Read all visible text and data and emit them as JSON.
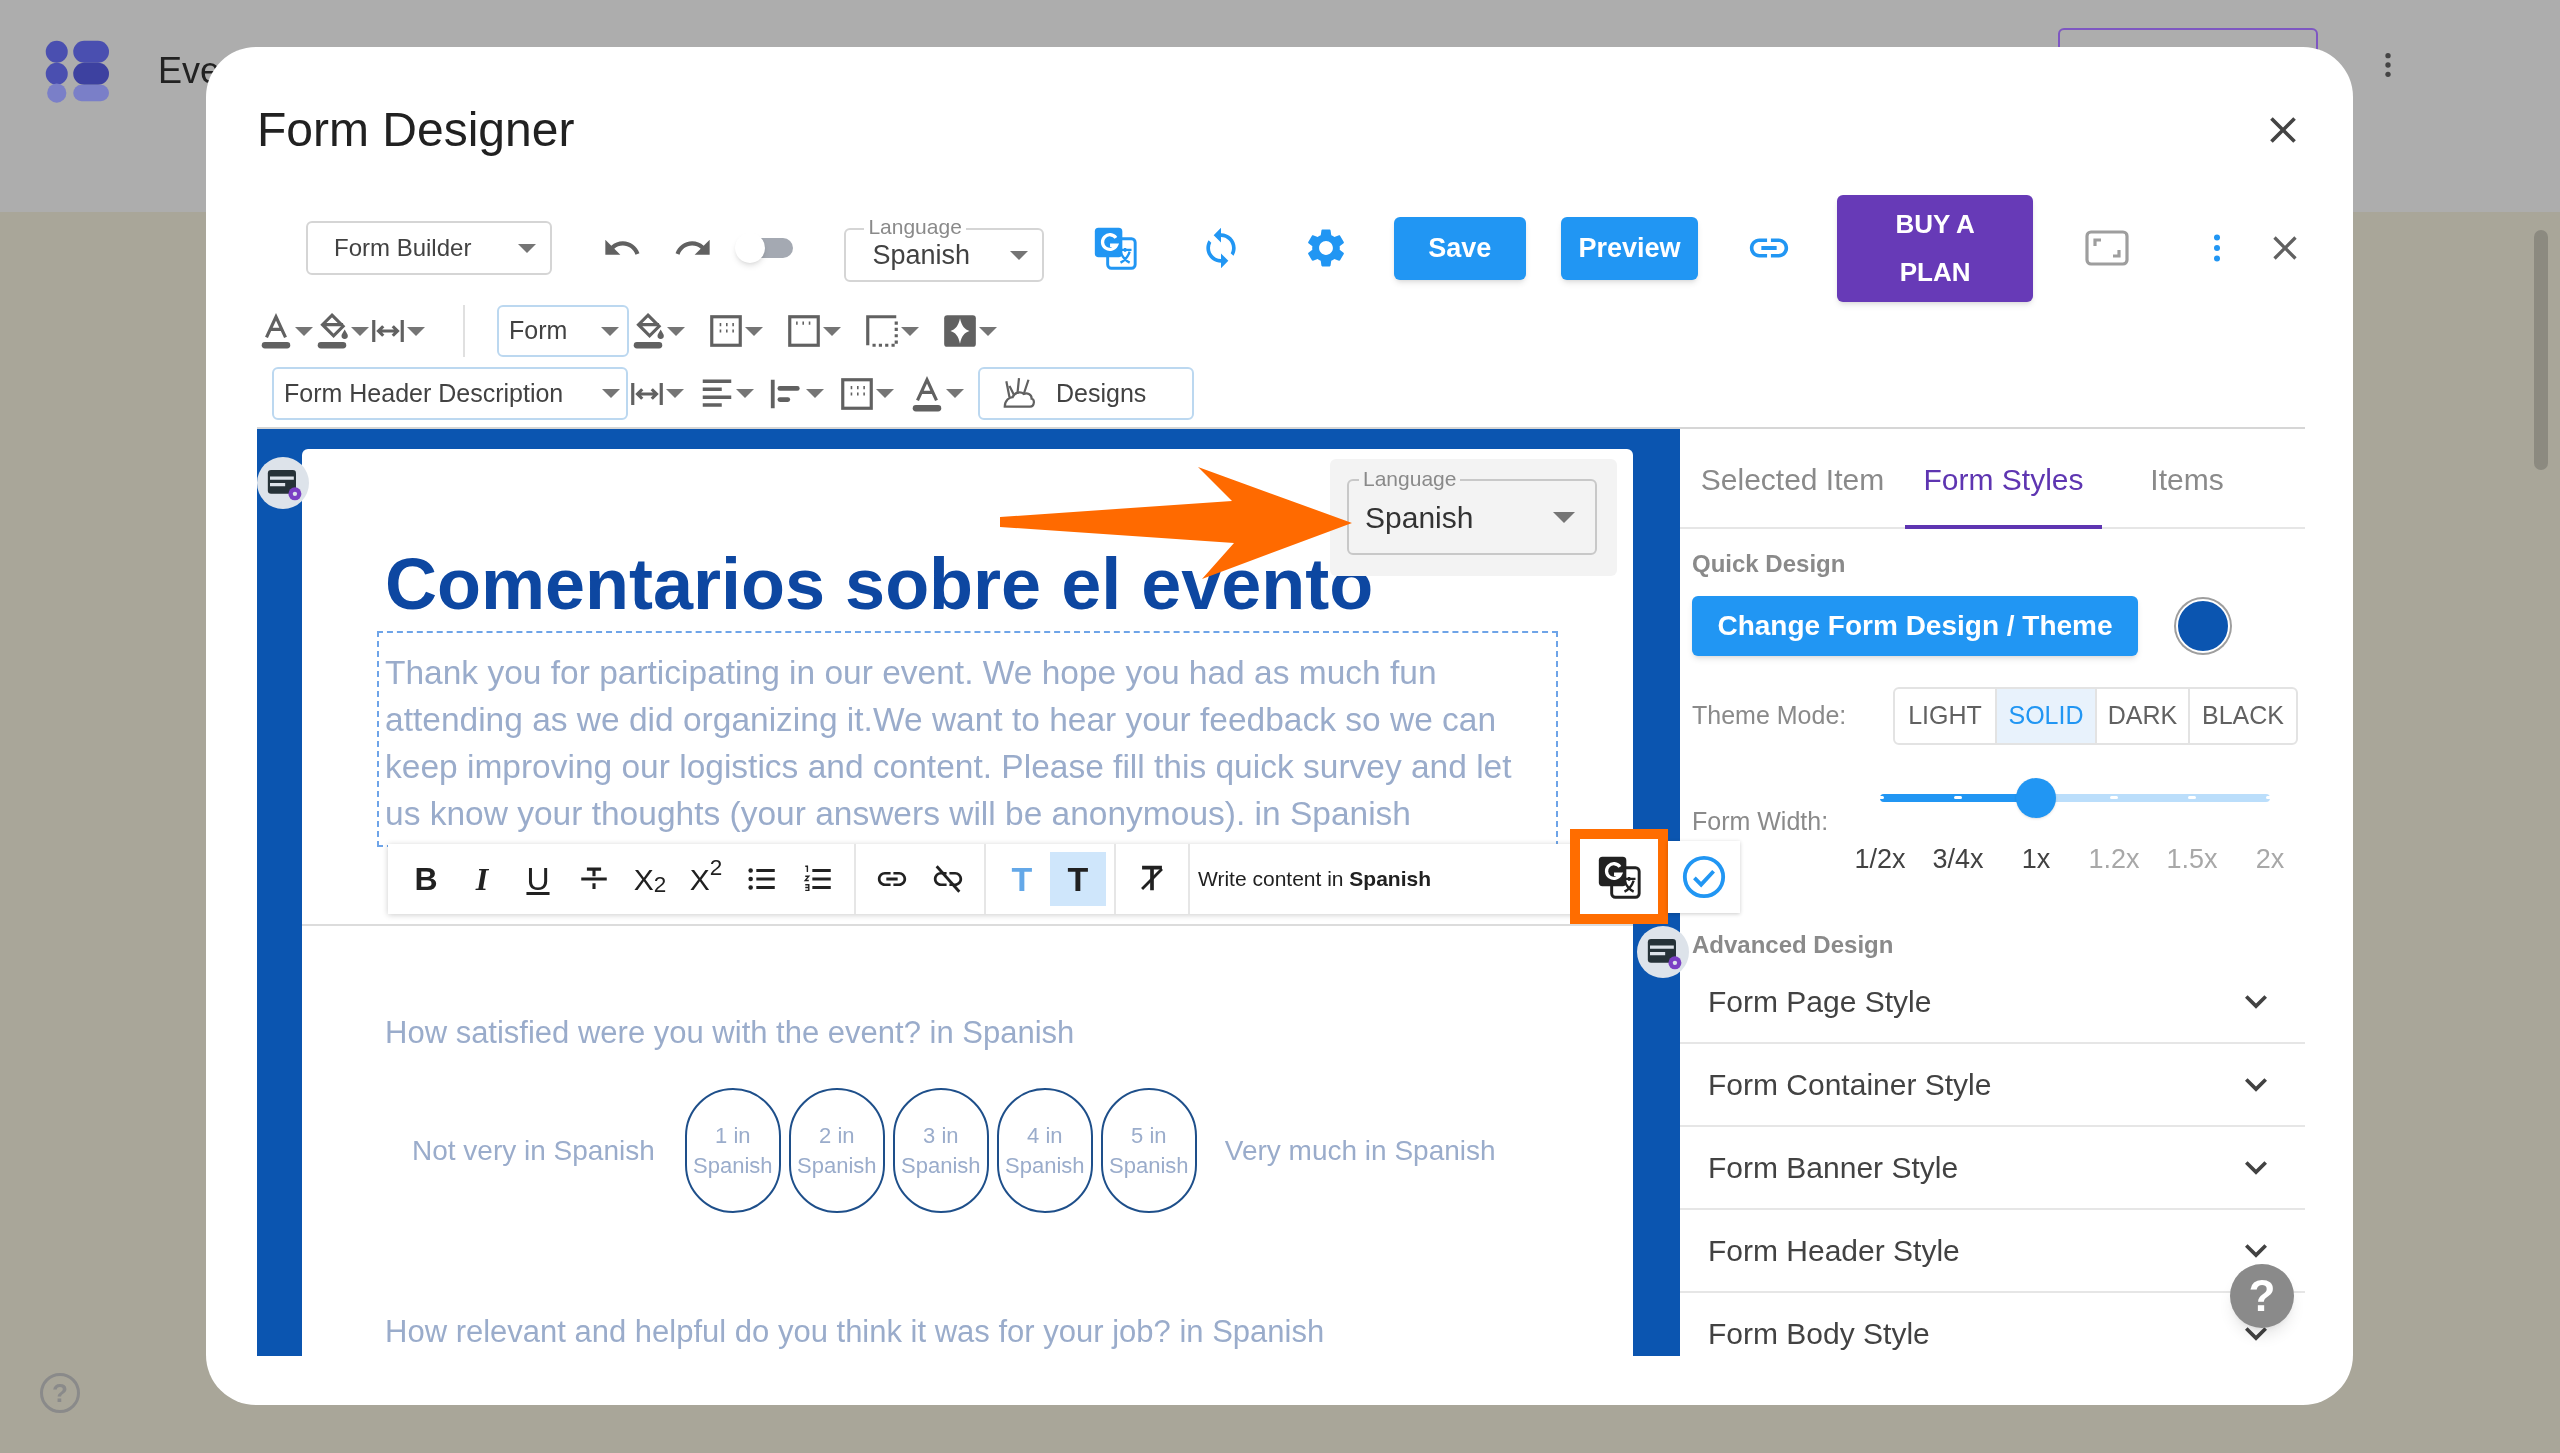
{
  "app_header": {
    "title": "Eve",
    "help_glyph": "?"
  },
  "dialog": {
    "title": "Form Designer"
  },
  "toolbar": {
    "view": "Form Builder",
    "sync_on": false,
    "language": {
      "label": "Language",
      "value": "Spanish"
    },
    "save": "Save",
    "preview": "Preview",
    "plan": "BUY A PLAN"
  },
  "format_bar": {
    "scope": "Form",
    "element": "Form Header Description",
    "designs": "Designs"
  },
  "form": {
    "language": {
      "label": "Language",
      "value": "Spanish"
    },
    "title": "Comentarios sobre el evento",
    "description": "Thank you for participating in our event. We hope you had as much fun attending as we did organizing it.We want to hear your feedback so we can keep improving our logistics and content. Please fill this quick survey and let us know your thoughts (your answers will be anonymous). in Spanish",
    "editor": {
      "tool_groups": [
        [
          {
            "kind": "bold",
            "glyph": "B",
            "active": false
          },
          {
            "kind": "italic",
            "glyph": "I",
            "active": false
          },
          {
            "kind": "underline",
            "glyph": "U",
            "active": false
          },
          {
            "kind": "strikethrough",
            "active": false
          },
          {
            "kind": "subscript",
            "glyph": "X$_{2}$",
            "active": false
          },
          {
            "kind": "superscript",
            "glyph": "X$^{2}$",
            "active": false
          },
          {
            "kind": "bullets",
            "active": false
          },
          {
            "kind": "numbered",
            "active": false
          }
        ],
        [
          {
            "kind": "link",
            "active": false
          },
          {
            "kind": "unlink",
            "active": false
          }
        ],
        [
          {
            "kind": "text-color",
            "glyph": "T",
            "active": false
          },
          {
            "kind": "highlight",
            "glyph": "T",
            "active": true
          }
        ],
        [
          {
            "kind": "clear-format",
            "active": false
          }
        ]
      ],
      "hint": "Write content in **Spanish**",
      "translate_highlighted": true
    },
    "questions": [
      {
        "text": "How satisfied were you with the event? in Spanish",
        "scale": {
          "low": "Not very in Spanish",
          "options": [
            "1 in Spanish",
            "2 in Spanish",
            "3 in Spanish",
            "4 in Spanish",
            "5 in Spanish"
          ],
          "high": "Very much in Spanish"
        }
      },
      {
        "text": "How relevant and helpful do you think it was for your job? in Spanish"
      }
    ]
  },
  "panel": {
    "tabs": [
      {
        "label": "Selected Item",
        "selected": false
      },
      {
        "label": "Form Styles",
        "selected": true
      },
      {
        "label": "Items",
        "selected": false
      }
    ],
    "quick_design": {
      "label": "Quick Design",
      "button": "Change Form Design / Theme",
      "color": "#0b55b0"
    },
    "theme_mode": {
      "label": "Theme Mode:",
      "options": [
        {
          "label": "LIGHT",
          "selected": false
        },
        {
          "label": "SOLID",
          "selected": true
        },
        {
          "label": "DARK",
          "selected": false
        },
        {
          "label": "BLACK",
          "selected": false
        }
      ]
    },
    "form_width": {
      "label": "Form Width:",
      "level": 0.4,
      "stops": [
        "1/2x",
        "3/4x",
        "1x",
        "1.2x",
        "1.5x",
        "2x"
      ]
    },
    "advanced": {
      "label": "Advanced Design",
      "sections": [
        {
          "label": "Form Page Style",
          "expanded": false
        },
        {
          "label": "Form Container Style",
          "expanded": false
        },
        {
          "label": "Form Banner Style",
          "expanded": false
        },
        {
          "label": "Form Header Style",
          "expanded": false
        },
        {
          "label": "Form Body Style",
          "expanded": false
        }
      ]
    },
    "help_glyph": "?"
  }
}
